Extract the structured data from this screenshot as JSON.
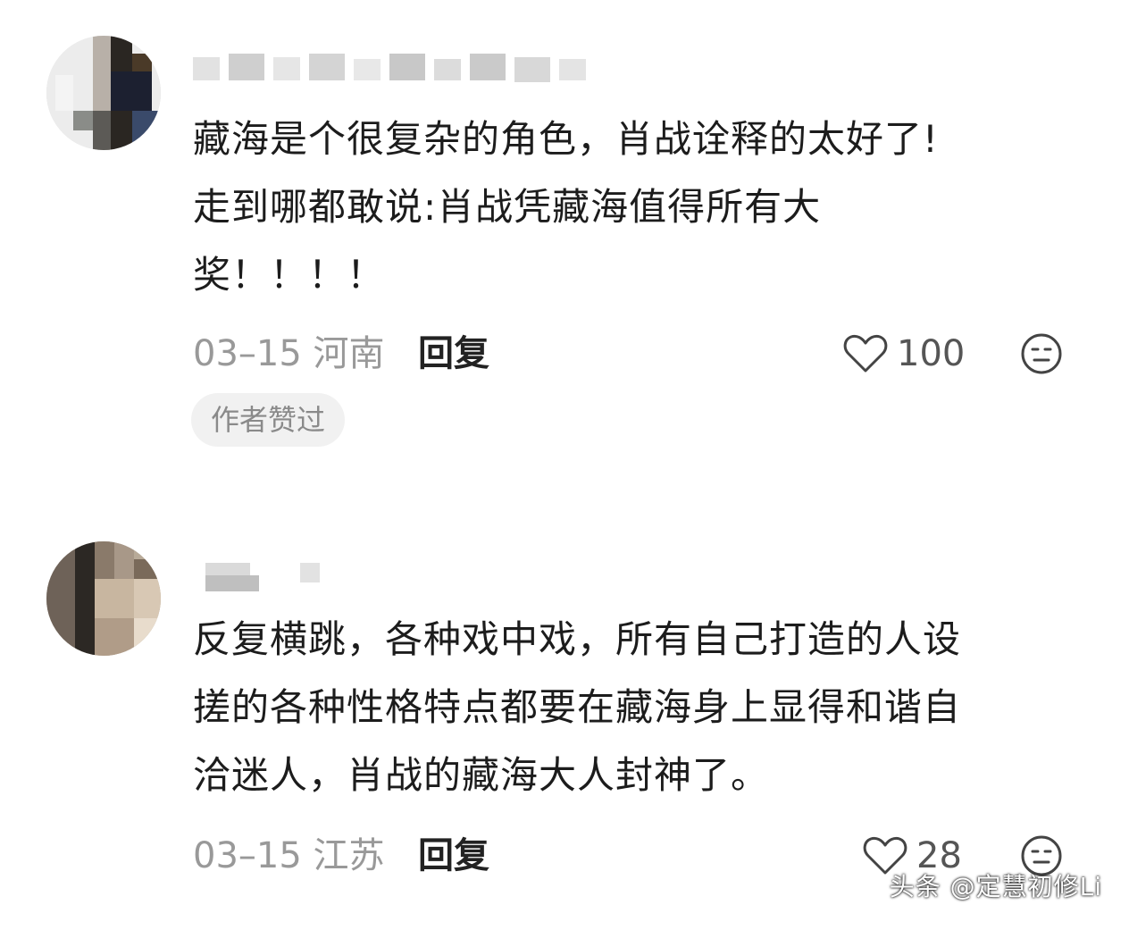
{
  "comments": [
    {
      "body_lines": [
        "藏海是个很复杂的角色，肖战诠释的太好了!",
        "走到哪都敢说:肖战凭藏海值得所有大",
        "奖！！！！"
      ],
      "date_location": "03–15 河南",
      "reply_label": "回复",
      "like_count": "100",
      "badge": "作者赞过"
    },
    {
      "body_lines": [
        "反复横跳，各种戏中戏，所有自己打造的人设",
        "搓的各种性格特点都要在藏海身上显得和谐自",
        "洽迷人，肖战的藏海大人封神了。"
      ],
      "date_location": "03–15 江苏",
      "reply_label": "回复",
      "like_count": "28"
    }
  ],
  "watermark": "头条 @定慧初修Li",
  "icons": {
    "like": "heart-outline-icon",
    "emoji": "neutral-face-icon"
  },
  "colors": {
    "meta_gray": "#999999",
    "badge_bg": "#f1f1f1",
    "text": "#1c1c1c"
  }
}
